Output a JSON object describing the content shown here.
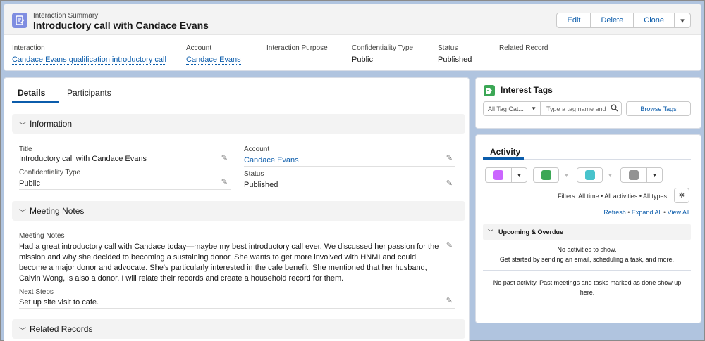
{
  "header": {
    "object_label": "Interaction Summary",
    "title": "Introductory call with Candace Evans",
    "buttons": {
      "edit": "Edit",
      "delete": "Delete",
      "clone": "Clone",
      "more": "▾"
    },
    "highlights": [
      {
        "label": "Interaction",
        "value": "Candace Evans qualification introductory call"
      },
      {
        "label": "Account",
        "value": "Candace Evans"
      },
      {
        "label": "Interaction Purpose",
        "value": ""
      },
      {
        "label": "Confidentiality Type",
        "value": "Public"
      },
      {
        "label": "Status",
        "value": "Published"
      },
      {
        "label": "Related Record",
        "value": ""
      }
    ]
  },
  "main": {
    "tabs": [
      {
        "label": "Details"
      },
      {
        "label": "Participants"
      }
    ],
    "sections": {
      "information": "Information",
      "meeting_notes": "Meeting Notes",
      "related_records": "Related Records"
    },
    "fields": {
      "title": {
        "label": "Title",
        "value": "Introductory call with Candace Evans"
      },
      "account": {
        "label": "Account",
        "value": "Candace Evans"
      },
      "confidentiality": {
        "label": "Confidentiality Type",
        "value": "Public"
      },
      "status": {
        "label": "Status",
        "value": "Published"
      },
      "notes": {
        "label": "Meeting Notes",
        "value": "Had a great introductory call with Candace today—maybe my best introductory call ever. We discussed her passion for the mission and why she decided to becoming a sustaining donor. She wants to get more involved with HNMI and could become a major donor and advocate. She's particularly interested in the cafe benefit. She mentioned that her husband, Calvin Wong, is also a donor. I will relate their records and create a household record for them."
      },
      "next_steps": {
        "label": "Next Steps",
        "value": "Set up site visit to cafe."
      }
    }
  },
  "tags": {
    "title": "Interest Tags",
    "category_select": "All Tag Cat...",
    "search_placeholder": "Type a tag name and",
    "browse_button": "Browse Tags"
  },
  "activity": {
    "tab": "Activity",
    "filters": "Filters: All time • All activities • All types",
    "links": {
      "refresh": "Refresh",
      "expand": "Expand All",
      "view": "View All",
      "sep": "•"
    },
    "upcoming_title": "Upcoming & Overdue",
    "no_activities": "No activities to show.",
    "no_activities_hint": "Get started by sending an email, scheduling a task, and more.",
    "no_past": "No past activity. Past meetings and tasks marked as done show up here."
  },
  "colors": {
    "brand": "#0b5cab",
    "record_icon": "#7f8de1",
    "tag_icon": "#3ba755",
    "event_icon": "#cb65ff",
    "task_icon": "#3ba755",
    "call_icon": "#48c3cc",
    "email_icon": "#939393"
  }
}
